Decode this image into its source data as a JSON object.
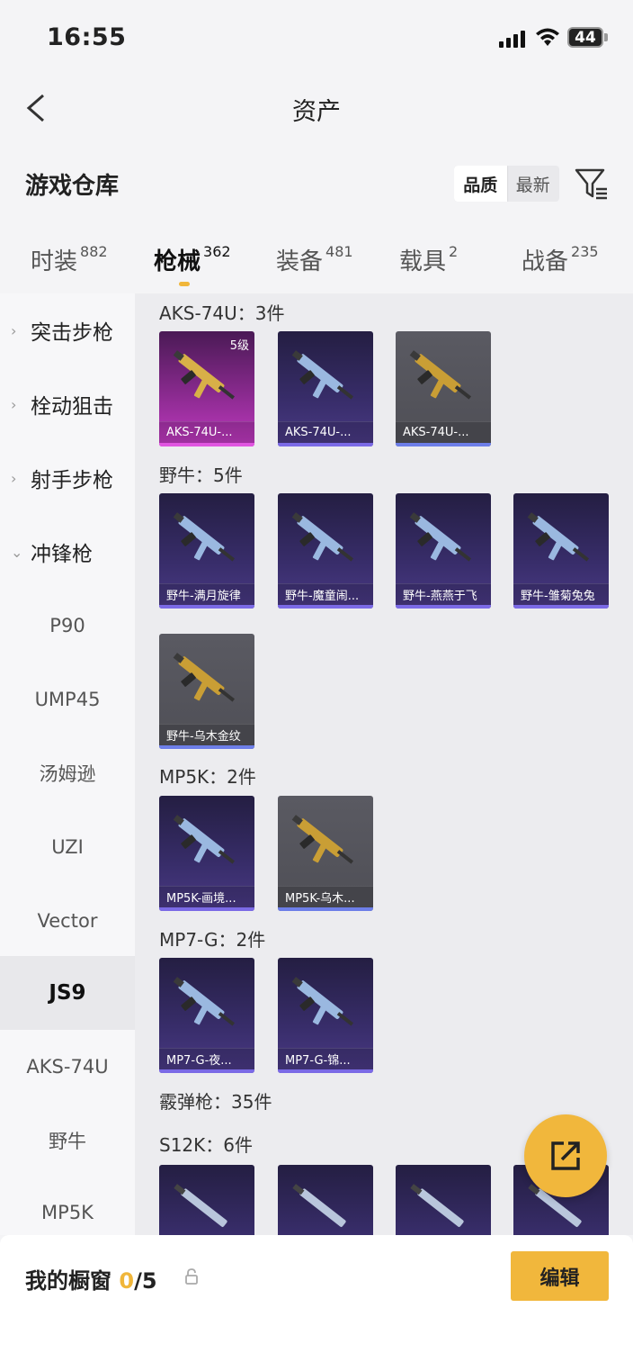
{
  "status_bar": {
    "time": "16:55",
    "battery": "44"
  },
  "header": {
    "title": "资产",
    "back_icon": "chevron-left-icon"
  },
  "warehouse": {
    "title": "游戏仓库",
    "sort_options": [
      "品质",
      "最新"
    ],
    "sort_selected": "品质",
    "filter_icon": "filter-icon"
  },
  "tabs": [
    {
      "label": "时装",
      "count": "882"
    },
    {
      "label": "枪械",
      "count": "362",
      "active": true
    },
    {
      "label": "装备",
      "count": "481"
    },
    {
      "label": "载具",
      "count": "2"
    },
    {
      "label": "战备",
      "count": "235"
    }
  ],
  "sidebar": {
    "categories": [
      "突击步枪",
      "栓动狙击",
      "射手步枪",
      "冲锋枪"
    ],
    "subitems": [
      "P90",
      "UMP45",
      "汤姆逊",
      "UZI",
      "Vector",
      "JS9",
      "AKS-74U",
      "野牛",
      "MP5K"
    ],
    "selected": "JS9"
  },
  "groups": [
    {
      "title": "AKS-74U：3件",
      "items": [
        {
          "label": "AKS-74U-...",
          "level": "5级",
          "rarity": "pink"
        },
        {
          "label": "AKS-74U-...",
          "rarity": "purple"
        },
        {
          "label": "AKS-74U-...",
          "rarity": "grey"
        }
      ]
    },
    {
      "title": "野牛：5件",
      "items": [
        {
          "label": "野牛-满月旋律",
          "rarity": "purple"
        },
        {
          "label": "野牛-魔童闹...",
          "rarity": "purple"
        },
        {
          "label": "野牛-燕燕于飞",
          "rarity": "purple"
        },
        {
          "label": "野牛-雏菊兔兔",
          "rarity": "purple"
        },
        {
          "label": "野牛-乌木金纹",
          "rarity": "grey"
        }
      ]
    },
    {
      "title": "MP5K：2件",
      "items": [
        {
          "label": "MP5K-画境...",
          "rarity": "purple"
        },
        {
          "label": "MP5K-乌木...",
          "rarity": "grey"
        }
      ]
    },
    {
      "title": "MP7-G：2件",
      "items": [
        {
          "label": "MP7-G-夜...",
          "rarity": "purple"
        },
        {
          "label": "MP7-G-锦...",
          "rarity": "purple"
        }
      ]
    },
    {
      "title": "霰弹枪：35件",
      "items": []
    },
    {
      "title": "S12K：6件",
      "items": []
    }
  ],
  "bottom": {
    "label": "我的橱窗",
    "count_used": "0",
    "count_total": "/5",
    "edit_label": "编辑"
  },
  "colors": {
    "accent": "#f1b73c",
    "purple_rarity": "#7b6ae6",
    "pink_rarity": "#e055e0"
  }
}
